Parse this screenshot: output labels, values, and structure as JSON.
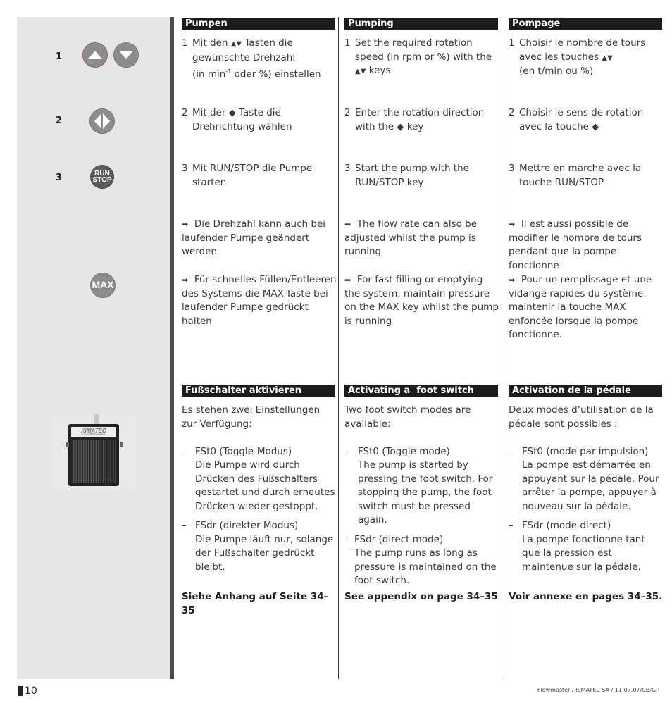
{
  "steps": [
    {
      "number": "1",
      "icon": "up-down-keys-icon"
    },
    {
      "number": "2",
      "icon": "direction-key-icon"
    },
    {
      "number": "3",
      "icon": "run-stop-key-icon",
      "key_label_top": "RUN",
      "key_label_bottom": "STOP"
    }
  ],
  "max_key": {
    "label": "MAX"
  },
  "photo": {
    "brand": "ISMATEC",
    "subtitle": "a unit of IDEX Corporation"
  },
  "columns": [
    {
      "lang": "de",
      "heading1": "Pumpen",
      "step1": {
        "n": "1",
        "pre": "Mit den",
        "sym": "▲▼",
        "post": "Tasten die gewünschte Drehzahl",
        "line3_pre": "(in min",
        "sup": "-1",
        "line3_post": " oder %) einstellen"
      },
      "step2": {
        "n": "2",
        "pre": "Mit der",
        "sym": "◆",
        "post": "Taste die Drehrichtung wählen"
      },
      "step3": {
        "n": "3",
        "text": "Mit RUN/STOP die Pumpe starten"
      },
      "note1": {
        "arrow": "➡",
        "text": "Die Drehzahl kann auch bei laufender Pumpe geändert werden"
      },
      "note2": {
        "arrow": "➡",
        "text": "Für schnelles Füllen/Entleeren des Systems die MAX-Taste bei laufender Pumpe gedrückt halten"
      },
      "heading2": "Fußschalter aktivieren",
      "intro": "Es stehen zwei Einstellungen zur Verfügung:",
      "modes": [
        {
          "dash": "–",
          "title": "FSt0 (Toggle-Modus)",
          "desc": "Die Pumpe wird durch Drücken des Fußschalters gestartet und durch erneutes Drücken wieder gestoppt."
        },
        {
          "dash": "–",
          "title": "FSdr (direkter Modus)",
          "desc": "Die Pumpe läuft nur, solange der Fußschalter gedrückt bleibt."
        }
      ],
      "ref": "Siehe Anhang auf Seite 34–35"
    },
    {
      "lang": "en",
      "heading1": "Pumping",
      "step1": {
        "n": "1",
        "pre": "Set the required rotation speed (in rpm or %) with the",
        "sym": "▲▼",
        "post": "keys"
      },
      "step2": {
        "n": "2",
        "pre": "Enter the rotation direction with the",
        "sym": "◆",
        "post": "key"
      },
      "step3": {
        "n": "3",
        "text": "Start the pump with the RUN/STOP key"
      },
      "note1": {
        "arrow": "➡",
        "text": "The flow rate can also be adjusted whilst the pump is running"
      },
      "note2": {
        "arrow": "➡",
        "text": "For fast filling or emptying the system, maintain pressure on the MAX key whilst the pump is running"
      },
      "heading2": "Activating a  foot switch",
      "intro": "Two foot switch modes are available:",
      "modes": [
        {
          "dash": "–",
          "title": "FSt0 (Toggle mode)",
          "desc": "The pump is started by pressing the foot switch. For stopping the pump, the foot switch must be pressed again."
        },
        {
          "dash": "–",
          "title": "FSdr (direct mode)",
          "desc": "The pump runs as long as pressure is maintained on the foot switch."
        }
      ],
      "ref": "See appendix on page 34–35"
    },
    {
      "lang": "fr",
      "heading1": "Pompage",
      "step1": {
        "n": "1",
        "pre": "Choisir le nombre de tours avec les touches",
        "sym": "▲▼",
        "post": "(en t/min ou %)"
      },
      "step2": {
        "n": "2",
        "pre": "Choisir le sens de rotation avec la touche",
        "sym": "◆",
        "post": ""
      },
      "step3": {
        "n": "3",
        "text": "Mettre en marche avec la touche RUN/STOP"
      },
      "note1": {
        "arrow": "➡",
        "text": "Il est aussi possible de modifier le nombre de tours pendant que la pompe fonctionne"
      },
      "note2": {
        "arrow": "➡",
        "text": "Pour un remplissage et une vidange rapides du système: maintenir la touche MAX enfoncée lorsque la pompe fonctionne."
      },
      "heading2": "Activation de la pédale",
      "intro": "Deux modes d’utilisation de la pédale sont possibles :",
      "modes": [
        {
          "dash": "–",
          "title": "FSt0 (mode par impulsion)",
          "desc": "La pompe est démarrée en appuyant sur la pédale. Pour arrêter la pompe, appuyer à nouveau sur la pédale."
        },
        {
          "dash": "–",
          "title": "FSdr (mode direct)",
          "desc": "La pompe fonctionne tant que la pression est maintenue sur la pédale."
        }
      ],
      "ref": "Voir annexe en pages 34–35."
    }
  ],
  "footer": {
    "page_number": "10",
    "credit": "Flowmaster / ISMATEC SA / 11.07.07/CB/GP"
  }
}
